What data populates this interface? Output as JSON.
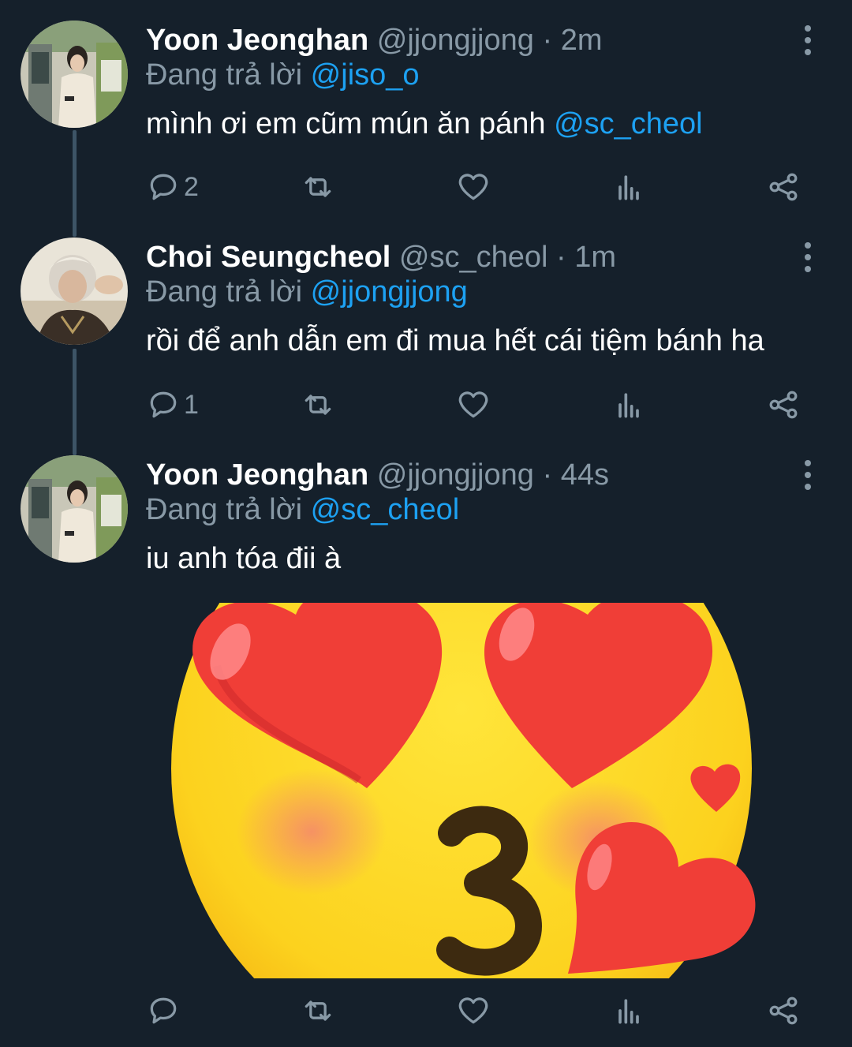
{
  "tweets": [
    {
      "name": "Yoon Jeonghan",
      "handle": "@jjongjjong",
      "time": "2m",
      "reply_prefix": "Đang trả lời",
      "reply_to": "@jiso_o",
      "text": "mình ơi em cũm mún ăn pánh",
      "text_mention": "@sc_cheol",
      "replies": "2"
    },
    {
      "name": "Choi Seungcheol",
      "handle": "@sc_cheol",
      "time": "1m",
      "reply_prefix": "Đang trả lời",
      "reply_to": "@jjongjjong",
      "text": "rồi để anh dẫn em đi mua hết cái tiệm bánh ha",
      "replies": "1"
    },
    {
      "name": "Yoon Jeonghan",
      "handle": "@jjongjjong",
      "time": "44s",
      "reply_prefix": "Đang trả lời",
      "reply_to": "@sc_cheol",
      "text": "iu anh tóa đii à",
      "media": "kissing-face-with-hearts-emoji"
    }
  ],
  "separator": " · ",
  "colors": {
    "background": "#15202b",
    "secondary_text": "#8899a6",
    "link": "#1da1f2",
    "thread_line": "#3d5466"
  },
  "icons": [
    "reply-icon",
    "retweet-icon",
    "like-icon",
    "analytics-icon",
    "share-icon",
    "more-icon"
  ]
}
